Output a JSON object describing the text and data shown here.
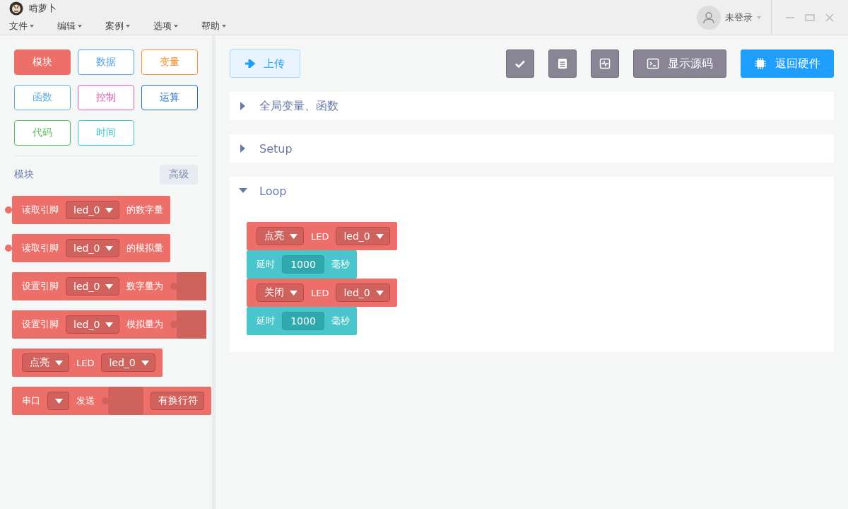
{
  "window": {
    "title": "啃萝卜",
    "menu": [
      {
        "label": "文件"
      },
      {
        "label": "编辑"
      },
      {
        "label": "案例"
      },
      {
        "label": "选项"
      },
      {
        "label": "帮助"
      }
    ],
    "user": {
      "label": "未登录"
    }
  },
  "categories": [
    {
      "label": "模块",
      "color": "#ec6f6a",
      "selected": true
    },
    {
      "label": "数据",
      "color": "#4e9ff5",
      "selected": false
    },
    {
      "label": "变量",
      "color": "#f7902c",
      "selected": false
    },
    {
      "label": "函数",
      "color": "#5aafd8",
      "selected": false
    },
    {
      "label": "控制",
      "color": "#d65cb2",
      "selected": false
    },
    {
      "label": "运算",
      "color": "#1c6fc5",
      "selected": false
    },
    {
      "label": "代码",
      "color": "#55bf59",
      "selected": false
    },
    {
      "label": "时间",
      "color": "#3fc6cb",
      "selected": false
    }
  ],
  "palette": {
    "title": "模块",
    "advanced_button": "高级",
    "blocks": [
      {
        "color": "#ec6f6a",
        "output": true,
        "parts": [
          {
            "kind": "text",
            "text": "读取引脚"
          },
          {
            "kind": "dropdown",
            "text": "led_0"
          },
          {
            "kind": "text",
            "text": "的数字量"
          }
        ]
      },
      {
        "color": "#ec6f6a",
        "output": true,
        "parts": [
          {
            "kind": "text",
            "text": "读取引脚"
          },
          {
            "kind": "dropdown",
            "text": "led_0"
          },
          {
            "kind": "text",
            "text": "的模拟量"
          }
        ]
      },
      {
        "color": "#ec6f6a",
        "output": false,
        "parts": [
          {
            "kind": "text",
            "text": "设置引脚"
          },
          {
            "kind": "dropdown",
            "text": "led_0"
          },
          {
            "kind": "text",
            "text": "数字量为"
          },
          {
            "kind": "socket"
          }
        ]
      },
      {
        "color": "#ec6f6a",
        "output": false,
        "parts": [
          {
            "kind": "text",
            "text": "设置引脚"
          },
          {
            "kind": "dropdown",
            "text": "led_0"
          },
          {
            "kind": "text",
            "text": "模拟量为"
          },
          {
            "kind": "socket"
          }
        ]
      },
      {
        "color": "#ec6f6a",
        "output": false,
        "parts": [
          {
            "kind": "dropdown",
            "text": "点亮"
          },
          {
            "kind": "text",
            "text": "LED"
          },
          {
            "kind": "dropdown",
            "text": "led_0"
          }
        ]
      },
      {
        "color": "#ec6f6a",
        "output": false,
        "parts": [
          {
            "kind": "text",
            "text": "串口"
          },
          {
            "kind": "dropdown"
          },
          {
            "kind": "text",
            "text": "发送"
          },
          {
            "kind": "socket"
          },
          {
            "kind": "dropdown_plain",
            "text": "有换行符"
          }
        ]
      }
    ]
  },
  "toolbar": {
    "upload": "上传",
    "icons": [
      {
        "kind": "check"
      },
      {
        "kind": "serial"
      },
      {
        "kind": "wave"
      }
    ],
    "source_button": "显示源码",
    "hardware_button": "返回硬件"
  },
  "sections": [
    {
      "title": "全局变量、函数",
      "expanded": false
    },
    {
      "title": "Setup",
      "expanded": false
    },
    {
      "title": "Loop",
      "expanded": true,
      "blocks": [
        {
          "color": "#ec6f6a",
          "parts": [
            {
              "kind": "dropdown",
              "text": "点亮"
            },
            {
              "kind": "text",
              "text": "LED"
            },
            {
              "kind": "dropdown",
              "text": "led_0"
            }
          ]
        },
        {
          "color": "#48c6cb",
          "parts": [
            {
              "kind": "text",
              "text": "延时"
            },
            {
              "kind": "input",
              "text": "1000"
            },
            {
              "kind": "text",
              "text": "毫秒"
            }
          ]
        },
        {
          "color": "#ec6f6a",
          "parts": [
            {
              "kind": "dropdown",
              "text": "关闭"
            },
            {
              "kind": "text",
              "text": "LED"
            },
            {
              "kind": "dropdown",
              "text": "led_0"
            }
          ]
        },
        {
          "color": "#48c6cb",
          "parts": [
            {
              "kind": "text",
              "text": "延时"
            },
            {
              "kind": "input",
              "text": "1000"
            },
            {
              "kind": "text",
              "text": "毫秒"
            }
          ]
        }
      ]
    }
  ]
}
